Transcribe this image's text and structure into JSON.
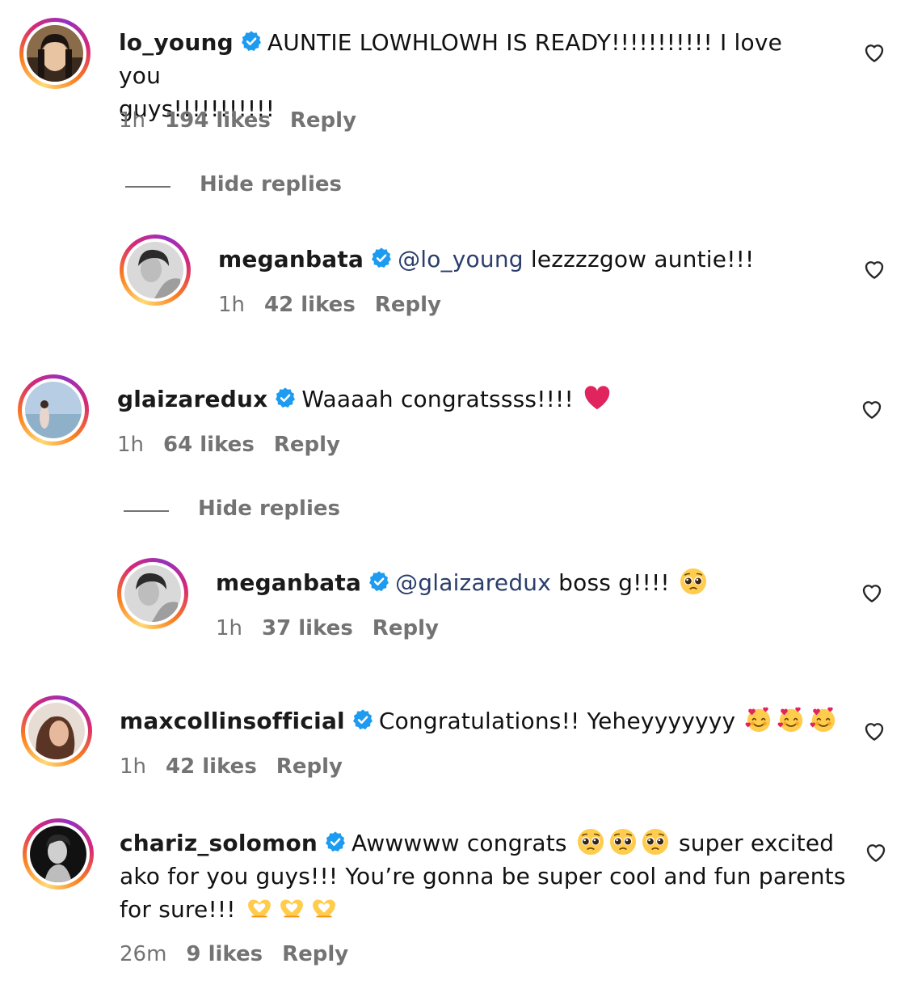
{
  "comments": [
    {
      "user": "lo_young",
      "text": "AUNTIE LOWHLOWH IS READY!!!!!!!!!!! I love you",
      "text2": "guys!!!!!!!!!!!",
      "time": "1h",
      "likes": "194 likes",
      "reply": "Reply",
      "hide": "Hide replies"
    },
    {
      "user": "meganbata",
      "mention": "@lo_young",
      "text": "lezzzzgow auntie!!!",
      "time": "1h",
      "likes": "42 likes",
      "reply": "Reply"
    },
    {
      "user": "glaizaredux",
      "text": "Waaaah congratssss!!!!",
      "time": "1h",
      "likes": "64 likes",
      "reply": "Reply",
      "hide": "Hide replies"
    },
    {
      "user": "meganbata",
      "mention": "@glaizaredux",
      "text": "boss g!!!!",
      "time": "1h",
      "likes": "37 likes",
      "reply": "Reply"
    },
    {
      "user": "maxcollinsofficial",
      "text": "Congratulations!! Yeheyyyyyyy",
      "time": "1h",
      "likes": "42 likes",
      "reply": "Reply"
    },
    {
      "user": "chariz_solomon",
      "text": "Awwwww congrats",
      "text_b": "super excited",
      "text2": "ako for you guys!!! You’re gonna be super cool and fun parents",
      "text3": "for sure!!!",
      "time": "26m",
      "likes": "9 likes",
      "reply": "Reply"
    }
  ],
  "icons": {
    "verified": "verified-badge-icon",
    "like": "heart-outline-icon",
    "emoji_heart": "red-heart-emoji",
    "emoji_pleading": "pleading-face-emoji",
    "emoji_hearts": "smiling-face-with-hearts-emoji",
    "emoji_hands": "heart-hands-emoji"
  },
  "colors": {
    "verified": "#1d9bf0",
    "meta": "#737373",
    "mention": "#2b3e6b",
    "red_heart": "#e0245e"
  }
}
